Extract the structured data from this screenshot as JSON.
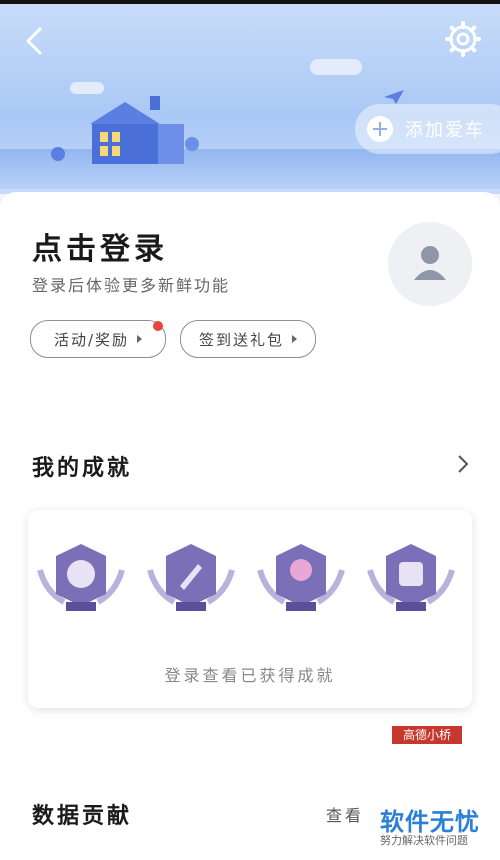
{
  "header": {
    "add_car_label": "添加爱车"
  },
  "login": {
    "title": "点击登录",
    "subtitle": "登录后体验更多新鲜功能",
    "activity_label": "活动/奖励",
    "checkin_label": "签到送礼包"
  },
  "achievements": {
    "title": "我的成就",
    "hint": "登录查看已获得成就",
    "badges": [
      "detective-badge",
      "rocket-badge",
      "location-badge",
      "bus-badge"
    ]
  },
  "data_contribution": {
    "title": "数据贡献",
    "link": "查看"
  },
  "watermark": {
    "brand": "软件无忧",
    "sub": "努力解决软件问题",
    "sign": "高德小桥"
  },
  "colors": {
    "accent": "#8fb0e8",
    "badge_purple": "#7b6fb8",
    "red_dot": "#e8453c"
  }
}
